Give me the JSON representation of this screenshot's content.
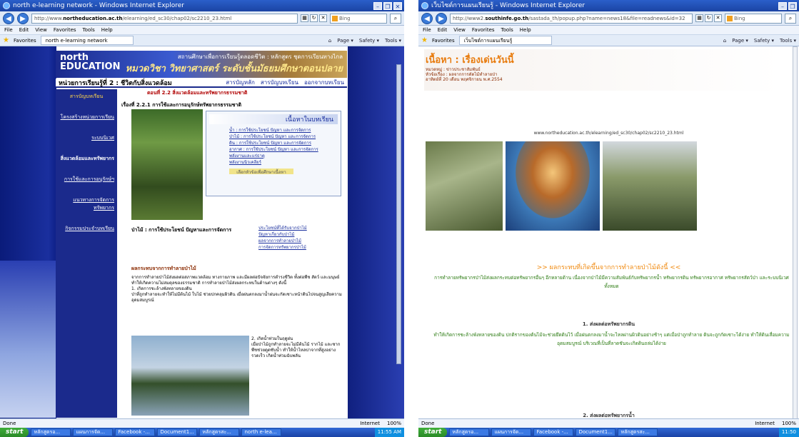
{
  "left": {
    "window_title": "north e-learning network - Windows Internet Explorer",
    "address_prefix": "http://www.",
    "address_domain": "northeducation.ac.th",
    "address_path": "/elearning/ed_sc30/chap02/sc2210_23.html",
    "search_provider": "Bing",
    "menu": [
      "File",
      "Edit",
      "View",
      "Favorites",
      "Tools",
      "Help"
    ],
    "favorites_label": "Favorites",
    "tab_label": "north e-learning network",
    "toolbar_items": [
      "Page ▾",
      "Safety ▾",
      "Tools ▾"
    ],
    "status_text": "Done",
    "status_zone": "Internet",
    "status_zoom": "100%",
    "page": {
      "logo_line1": "north",
      "logo_line2": "EDUCATION",
      "header_line1": "สถานศึกษาเพื่อการเรียนรู้ตลอดชีวิต : หลักสูตร ชุดการเรียนทางไกล",
      "header_line2": "หมวดวิชา วิทยาศาสตร์ ระดับชั้นมัธยมศึกษาตอนปลาย",
      "unit_title": "หน่วยการเรียนรู้ที่ 2 : ชีวิตกับสิ่งแวดล้อม",
      "unit_links": [
        "สารบัญหลัก",
        "สารบัญบทเรียน",
        "ออกจากบทเรียน"
      ],
      "side_items": [
        "สารบัญบทเรียน",
        "โครงสร้างหน่วยการเรียน",
        "ระบบนิเวศ",
        "สิ่งแวดล้อมและทรัพยากร",
        "การใช้และการอนุรักษ์ฯ",
        "แนวทางการจัดการทรัพยากร",
        "กิจกรรมประจำบทเรียน"
      ],
      "section_heading": "ตอนที่ 2.2 สิ่งแวดล้อมและทรัพยากรธรรมชาติ",
      "story_heading": "เรื่องที่ 2.2.1   การใช้และการอนุรักษ์ทรัพยากรธรรมชาติ",
      "content_box_title": "เนื้อหาในบทเรียน",
      "content_items": [
        "น้ำ : การใช้ประโยชน์ ปัญหา และการจัดการ",
        "ป่าไม้ : การใช้ประโยชน์ ปัญหา และการจัดการ",
        "ดิน : การใช้ประโยชน์ ปัญหา และการจัดการ",
        "อากาศ : การใช้ประโยชน์ ปัญหา และการจัดการ",
        "พลังงานและแร่ธาตุ",
        "พลังงานนิวเคลียร์"
      ],
      "content_note": "เลือกหัวข้อเพื่อศึกษาเนื้อหา",
      "forest_caption": "ป่าไม้ : การใช้ประโยชน์ ปัญหาและการจัดการ",
      "forest_links": [
        "ประโยชน์ที่ได้รับจากป่าไม้",
        "ปัญหาเกี่ยวกับป่าไม้",
        "ผลจากการทำลายป่าไม้",
        "การจัดการทรัพยากรป่าไม้"
      ],
      "effect_title": "ผลกระทบจากการทำลายป่าไม้",
      "effect_text": "จากการทำลายป่าไม้ส่งผลต่อสภาพแวดล้อม ทางกายภาพ และมีผลต่อปัจจัยการดำรงชีวิต ทั้งต่อพืช สัตว์ และมนุษย์ ทำให้เกิดความไม่สมดุลของธรรมชาติ การทำลายป่าไม้ส่งผลกระทบในด้านต่างๆ ดังนี้",
      "effect_point1": "1. เกิดการชะล้างพังทลายของดิน",
      "effect_point1_text": "ป่าที่ถูกทำลายจะทำให้ไม่มีต้นไม้ ใบไม้ ช่วยปกคลุมผิวดิน เมื่อฝนตกลงมาน้ำฝนจะกัดเซาะหน้าดินไปจนสูญเสียความอุดมสมบูรณ์",
      "effect_point2": "2. เกิดน้ำท่วมในฤดูฝน",
      "effect_point2_text": "เมื่อป่าไม้ถูกทำลายจะไม่มีต้นไม้ รากไม้ และซากพืชช่วยดูดซับน้ำ ทำให้น้ำไหลบ่าจากที่สูงอย่างรวดเร็ว เกิดน้ำท่วมฉับพลัน"
    }
  },
  "right": {
    "window_title": "เว็บไซต์การแผนเรียนรู้ - Windows Internet Explorer",
    "address_prefix": "http://www2.",
    "address_domain": "southinfe.go.th",
    "address_path": "/sastada_th/popup.php?name=news18&file=readnews&id=32",
    "search_provider": "Bing",
    "menu": [
      "File",
      "Edit",
      "View",
      "Favorites",
      "Tools",
      "Help"
    ],
    "favorites_label": "Favorites",
    "tab_label": "เว็บไซต์การแผนเรียนรู้",
    "toolbar_items": [
      "Page ▾",
      "Safety ▾",
      "Tools ▾"
    ],
    "status_text": "Done",
    "status_zone": "Internet",
    "status_zoom": "100%",
    "page": {
      "title": "เนื้อหา : เรื่องเด่นวันนี้",
      "meta1": "หมวดหมู่ : ข่าวประชาสัมพันธ์",
      "meta2": "หัวข้อเรื่อง : ผลจากการตัดไม้ทำลายป่า",
      "meta3": "อาทิตย์ที่ 20 เดือน พฤศจิกายน พ.ศ.2554",
      "source_url": "www.northeducation.ac.th/elearning/ed_sc30/chap02/sc2210_23.html",
      "headline": ">> ผลกระทบที่เกิดขึ้นจากการทำลายป่าไม้ดังนี้ <<",
      "intro": "การทำลายทรัพยากรป่าไม้ส่งผลกระทบต่อทรัพยากรอื่นๆ อีกหลายด้าน เนื่องจากป่าไม้มีความสัมพันธ์กับทรัพยากรน้ำ ทรัพยากรดิน ทรัพยากรอากาศ ทรัพยากรสัตว์ป่า และระบบนิเวศทั้งหมด",
      "sub1": "1. ส่งผลต่อทรัพยากรดิน",
      "sub1_text": "ทำให้เกิดการชะล้างพังทลายของดิน ปกติรากของต้นไม้จะช่วยยึดดินไว้ เมื่อฝนตกลงมาน้ำจะไหลผ่านผิวดินอย่างช้าๆ แต่เมื่อป่าถูกทำลาย ดินจะถูกกัดเซาะได้ง่าย ทำให้ดินเสื่อมความอุดมสมบูรณ์ บริเวณที่เป็นที่ลาดชันจะเกิดดินถล่มได้ง่าย",
      "sub2": "2. ส่งผลต่อทรัพยากรน้ำ"
    }
  },
  "taskbar": {
    "start": "start",
    "items": [
      "หลักสูตรอ...",
      "แผนการจัด...",
      "Facebook -...",
      "Document1...",
      "หลักสูตรสะ...",
      "north e-lea..."
    ],
    "clock_left": "11:55 AM",
    "clock_right": "11:50"
  }
}
